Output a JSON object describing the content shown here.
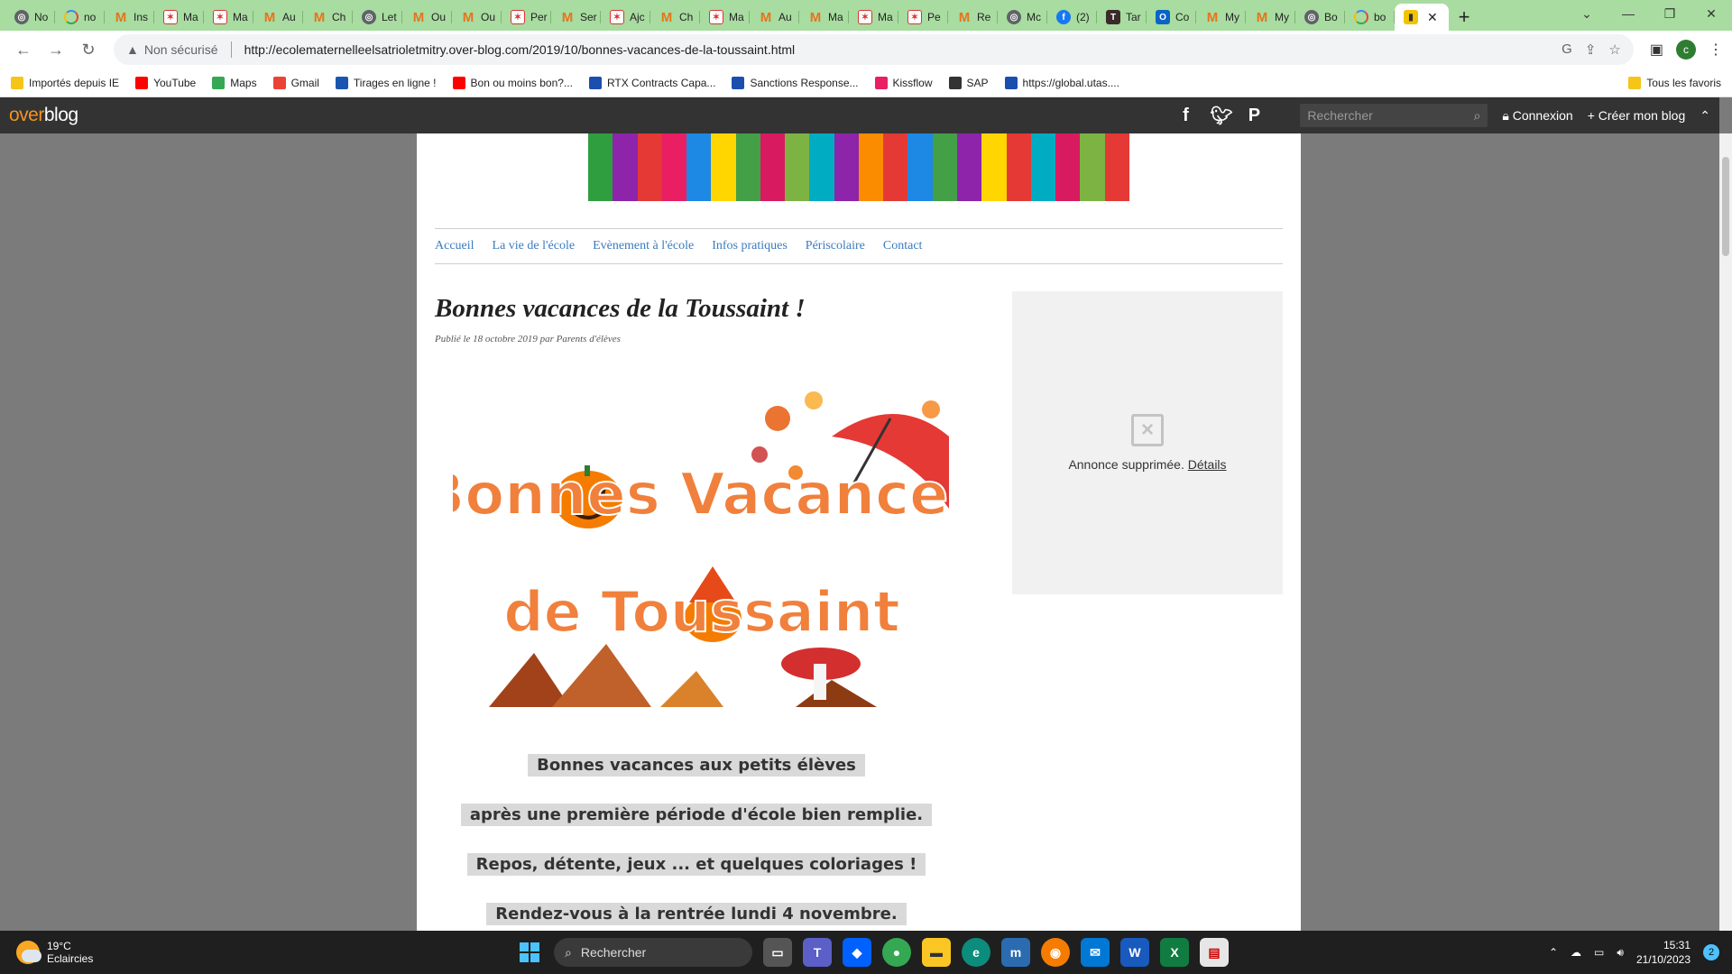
{
  "tabs": [
    {
      "label": "No",
      "icon": "globe"
    },
    {
      "label": "no",
      "icon": "g"
    },
    {
      "label": "Ins",
      "icon": "m"
    },
    {
      "label": "Ma",
      "icon": "star"
    },
    {
      "label": "Ma",
      "icon": "star"
    },
    {
      "label": "Au",
      "icon": "m"
    },
    {
      "label": "Ch",
      "icon": "m"
    },
    {
      "label": "Let",
      "icon": "globe"
    },
    {
      "label": "Ou",
      "icon": "m"
    },
    {
      "label": "Ou",
      "icon": "m"
    },
    {
      "label": "Per",
      "icon": "star"
    },
    {
      "label": "Ser",
      "icon": "m"
    },
    {
      "label": "Ajc",
      "icon": "star"
    },
    {
      "label": "Ch",
      "icon": "m"
    },
    {
      "label": "Ma",
      "icon": "star"
    },
    {
      "label": "Au",
      "icon": "m"
    },
    {
      "label": "Ma",
      "icon": "m"
    },
    {
      "label": "Ma",
      "icon": "star"
    },
    {
      "label": "Pe",
      "icon": "star"
    },
    {
      "label": "Re",
      "icon": "m"
    },
    {
      "label": "Mc",
      "icon": "globe"
    },
    {
      "label": "(2)",
      "icon": "fb"
    },
    {
      "label": "Tar",
      "icon": "tar"
    },
    {
      "label": "Co",
      "icon": "ol"
    },
    {
      "label": "My",
      "icon": "m"
    },
    {
      "label": "My",
      "icon": "m"
    },
    {
      "label": "Bo",
      "icon": "globe"
    },
    {
      "label": "bo",
      "icon": "g"
    }
  ],
  "active_tab": {
    "icon": "ob",
    "close": "✕"
  },
  "new_tab": "+",
  "address": {
    "security": "Non sécurisé",
    "url": "http://ecolematernelleelsatrioletmitry.over-blog.com/2019/10/bonnes-vacances-de-la-toussaint.html"
  },
  "profile_initial": "c",
  "bookmarks": [
    {
      "label": "Importés depuis IE",
      "color": "#f5c518"
    },
    {
      "label": "YouTube",
      "color": "#ff0000"
    },
    {
      "label": "Maps",
      "color": "#34a853"
    },
    {
      "label": "Gmail",
      "color": "#ea4335"
    },
    {
      "label": "Tirages en ligne !",
      "color": "#1a56b0"
    },
    {
      "label": "Bon ou moins bon?...",
      "color": "#ff0000"
    },
    {
      "label": "RTX Contracts Capa...",
      "color": "#1a4fb0"
    },
    {
      "label": "Sanctions Response...",
      "color": "#1a4fb0"
    },
    {
      "label": "Kissflow",
      "color": "#e91e63"
    },
    {
      "label": "SAP",
      "color": "#333333"
    },
    {
      "label": "https://global.utas....",
      "color": "#1a4fb0"
    }
  ],
  "bookmarks_right": "Tous les favoris",
  "overblog": {
    "logo_over": "over",
    "logo_blog": "blog",
    "search_placeholder": "Rechercher",
    "login": "Connexion",
    "create": "Créer mon blog"
  },
  "site_nav": [
    "Accueil",
    "La vie de l'école",
    "Evènement à l'école",
    "Infos pratiques",
    "Périscolaire",
    "Contact"
  ],
  "article": {
    "title": "Bonnes vacances de la Toussaint !",
    "meta": "Publié le 18 octobre 2019 par Parents d'élèves",
    "hero_line1": "Bonnes Vacances",
    "hero_line2": "de Toussaint",
    "lines": [
      "Bonnes vacances aux petits élèves",
      "après une première période d'école bien remplie.",
      "Repos, détente, jeux ... et quelques coloriages !",
      "Rendez-vous à la rentrée lundi 4 novembre."
    ]
  },
  "ad": {
    "text": "Annonce supprimée.",
    "link": "Détails"
  },
  "banner_colors": [
    "#2e9e3e",
    "#8e24aa",
    "#e53935",
    "#e91e63",
    "#1e88e5",
    "#ffd600",
    "#43a047",
    "#d81b60",
    "#7cb342",
    "#00acc1",
    "#8e24aa",
    "#fb8c00",
    "#e53935",
    "#1e88e5",
    "#43a047",
    "#8e24aa",
    "#ffd600",
    "#e53935",
    "#00acc1",
    "#d81b60",
    "#7cb342",
    "#e53935"
  ],
  "taskbar": {
    "temp": "19°C",
    "weather": "Eclaircies",
    "search": "Rechercher",
    "time": "15:31",
    "date": "21/10/2023",
    "notifications": "2"
  }
}
